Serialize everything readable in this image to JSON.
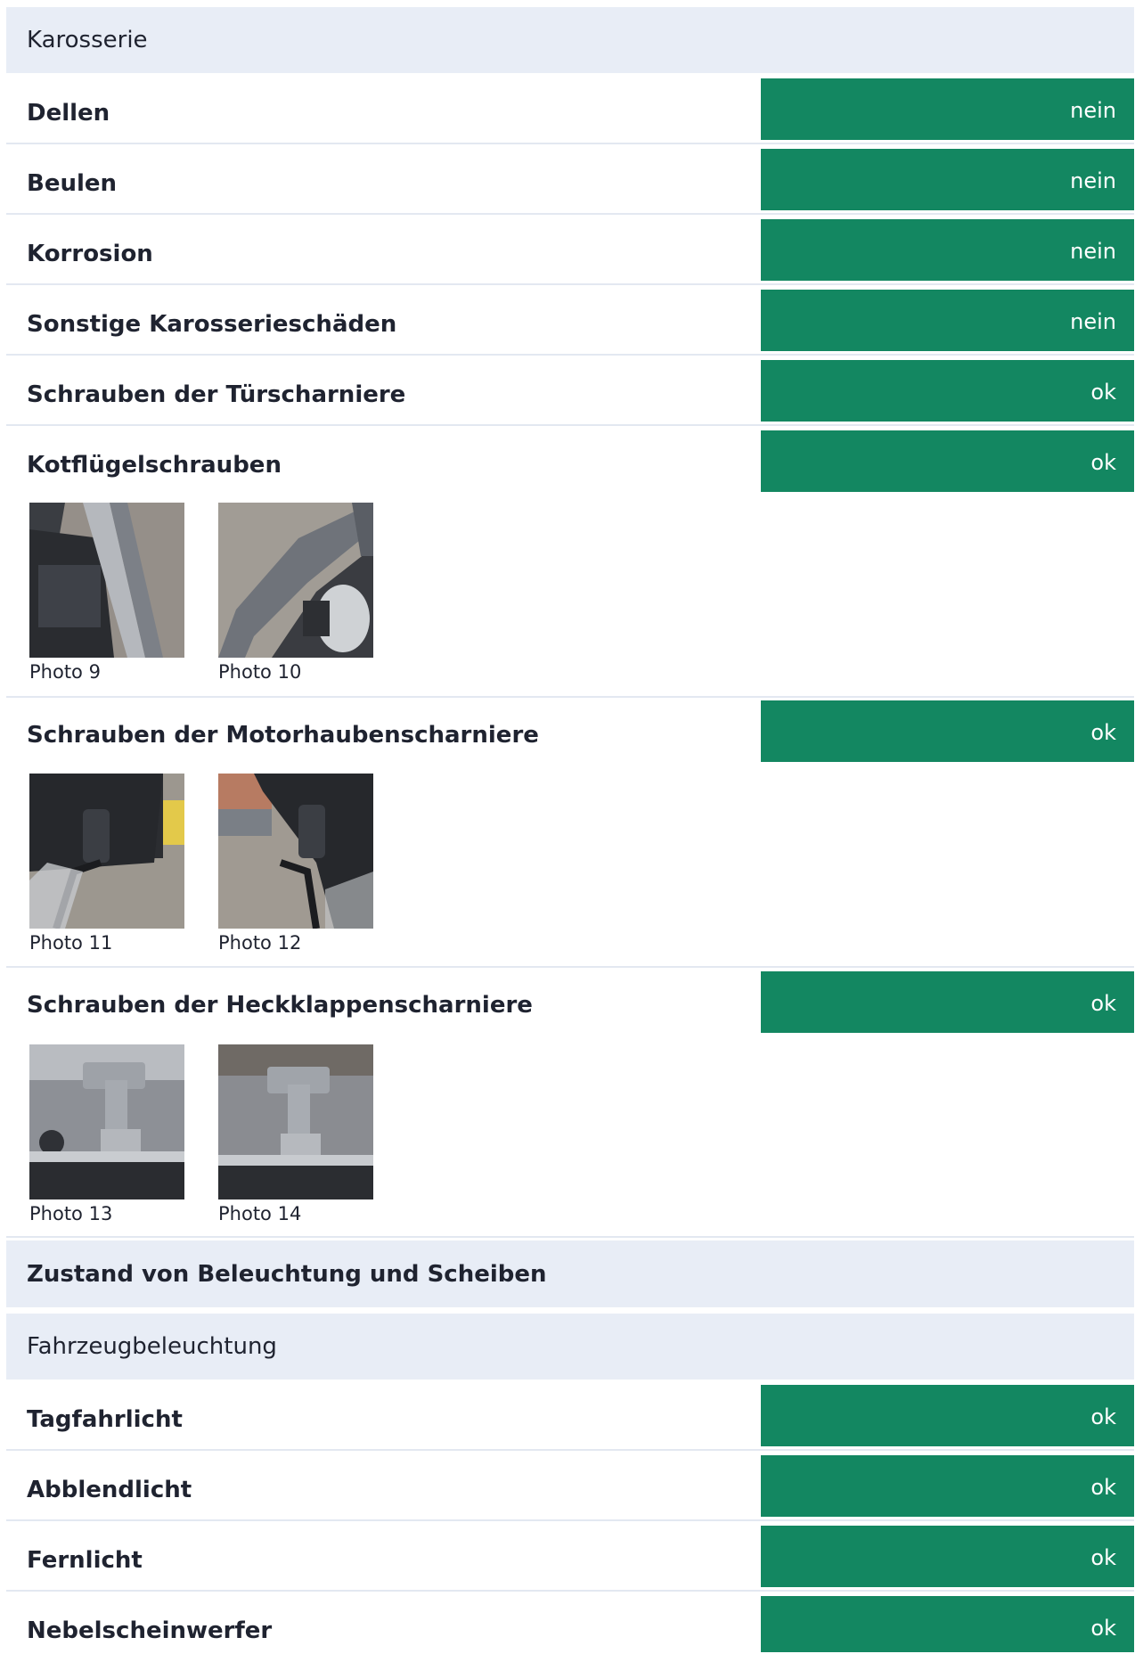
{
  "sections": {
    "karosserie": "Karosserie",
    "zustand": "Zustand von Beleuchtung und Scheiben",
    "beleuchtung": "Fahrzeugbeleuchtung"
  },
  "rows": [
    {
      "label": "Dellen",
      "status": "nein"
    },
    {
      "label": "Beulen",
      "status": "nein"
    },
    {
      "label": "Korrosion",
      "status": "nein"
    },
    {
      "label": "Sonstige Karosserieschäden",
      "status": "nein"
    },
    {
      "label": "Schrauben der Türscharniere",
      "status": "ok"
    },
    {
      "label": "Kotflügelschrauben",
      "status": "ok"
    },
    {
      "label": "Schrauben der Motorhaubenscharniere",
      "status": "ok"
    },
    {
      "label": "Schrauben der Heckklappenscharniere",
      "status": "ok"
    },
    {
      "label": "Tagfahrlicht",
      "status": "ok"
    },
    {
      "label": "Abblendlicht",
      "status": "ok"
    },
    {
      "label": "Fernlicht",
      "status": "ok"
    },
    {
      "label": "Nebelscheinwerfer",
      "status": "ok"
    }
  ],
  "photos": {
    "kotfluegel": [
      "Photo 9",
      "Photo 10"
    ],
    "motorhaube": [
      "Photo 11",
      "Photo 12"
    ],
    "heckklappe": [
      "Photo 13",
      "Photo 14"
    ]
  },
  "colors": {
    "status_bg": "#138761",
    "section_bg": "#e8edf6",
    "divider": "#e3e8f1"
  }
}
